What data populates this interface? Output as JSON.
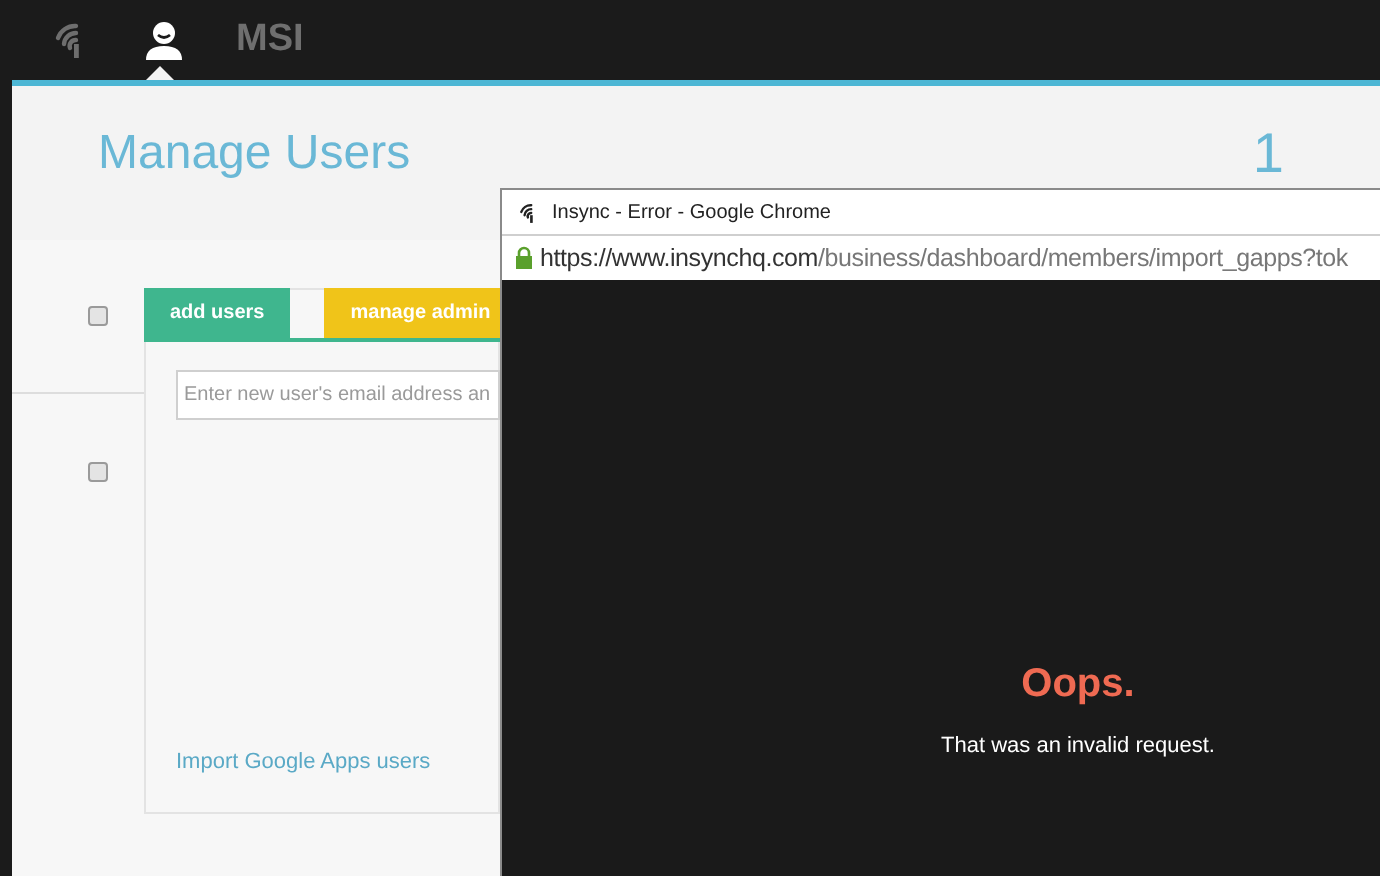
{
  "top_bar": {
    "account": "MSI"
  },
  "page": {
    "title": "Manage Users",
    "count": "1"
  },
  "rows": [
    {
      "checked": false
    },
    {
      "checked": false
    }
  ],
  "card": {
    "tabs": [
      {
        "label": "add users",
        "selected": true,
        "color": "#3fb68e"
      },
      {
        "label": "manage admin",
        "selected": false,
        "color": "#f0c419"
      }
    ],
    "email_field": {
      "placeholder": "Enter new user's email address an"
    },
    "import_link": "Import Google Apps users"
  },
  "browser_window": {
    "title": "Insync - Error - Google Chrome",
    "url_host": "https://www.insynchq.com",
    "url_path": "/business/dashboard/members/import_gapps?tok",
    "error": {
      "heading": "Oops.",
      "message": "That was an invalid request."
    }
  }
}
